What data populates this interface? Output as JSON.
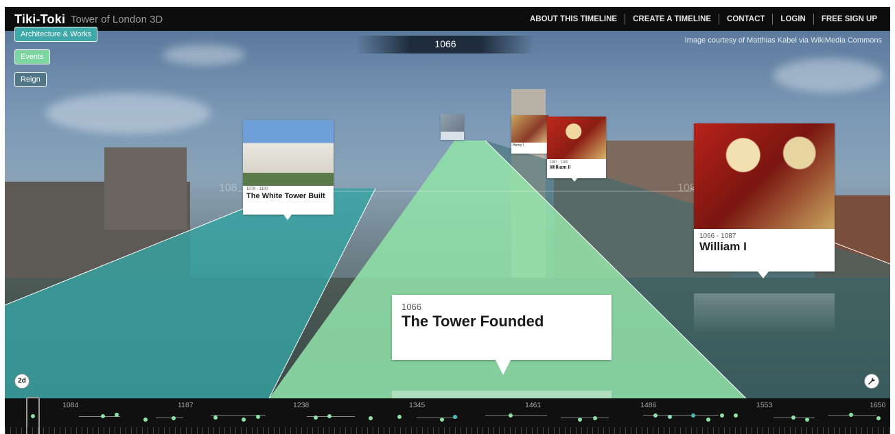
{
  "header": {
    "brand": "Tiki-Toki",
    "timeline_title": "Tower of London 3D",
    "nav": [
      "ABOUT THIS TIMELINE",
      "CREATE A TIMELINE",
      "CONTACT",
      "LOGIN",
      "FREE SIGN UP"
    ]
  },
  "scene": {
    "current_year": "1066",
    "image_credit": "Image courtesy of Matthias Kabel via WikiMedia Commons",
    "faded_year_left": "108",
    "faded_year_right": "108"
  },
  "categories": [
    {
      "label": "Architecture & Works",
      "color": "#3ea9a8"
    },
    {
      "label": "Events",
      "color": "#7dd5a0"
    },
    {
      "label": "Reign",
      "color": "#466e78"
    }
  ],
  "stories": {
    "tower_founded": {
      "date": "1066",
      "title": "The Tower Founded"
    },
    "william_i": {
      "date": "1066 - 1087",
      "title": "William I"
    },
    "white_tower": {
      "date": "1078 - 1100",
      "title": "The White Tower Built"
    },
    "william_ii": {
      "date": "1087 - 1100",
      "title": "William II"
    },
    "henry_i": {
      "title": "Henry I"
    }
  },
  "controls": {
    "view_toggle": "2d"
  },
  "timeline_strip": {
    "ticks": [
      "1084",
      "1187",
      "1238",
      "1345",
      "1461",
      "1486",
      "1553",
      "1650"
    ]
  }
}
